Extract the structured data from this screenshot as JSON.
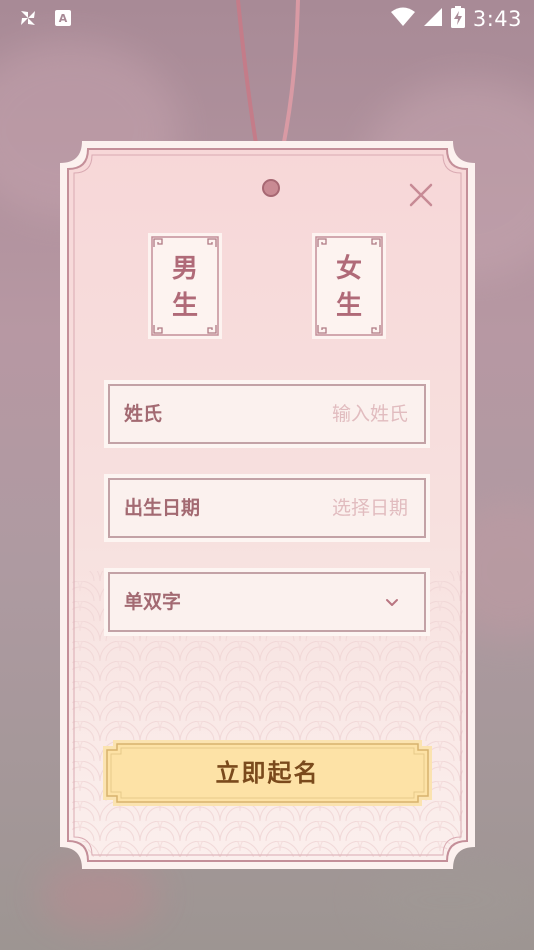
{
  "status_bar": {
    "time": "3:43",
    "left_icons": [
      "pinwheel-icon",
      "keyboard-a-icon"
    ],
    "right_icons": [
      "wifi-icon",
      "signal-icon",
      "battery-charging-icon"
    ]
  },
  "dialog": {
    "close_icon": "close-icon",
    "gender_options": [
      {
        "line1": "男",
        "line2": "生"
      },
      {
        "line1": "女",
        "line2": "生"
      }
    ],
    "fields": {
      "surname": {
        "label": "姓氏",
        "placeholder": "输入姓氏"
      },
      "birth_date": {
        "label": "出生日期",
        "placeholder": "选择日期"
      },
      "name_length": {
        "label": "单双字",
        "icon": "chevron-down-icon"
      }
    },
    "submit_label": "立即起名"
  },
  "colors": {
    "card_fill": "#f9e0e0",
    "card_border": "#c48f99",
    "accent_text": "#a36a72",
    "button_fill": "#fde2a6",
    "button_text": "#7a4a1c"
  }
}
